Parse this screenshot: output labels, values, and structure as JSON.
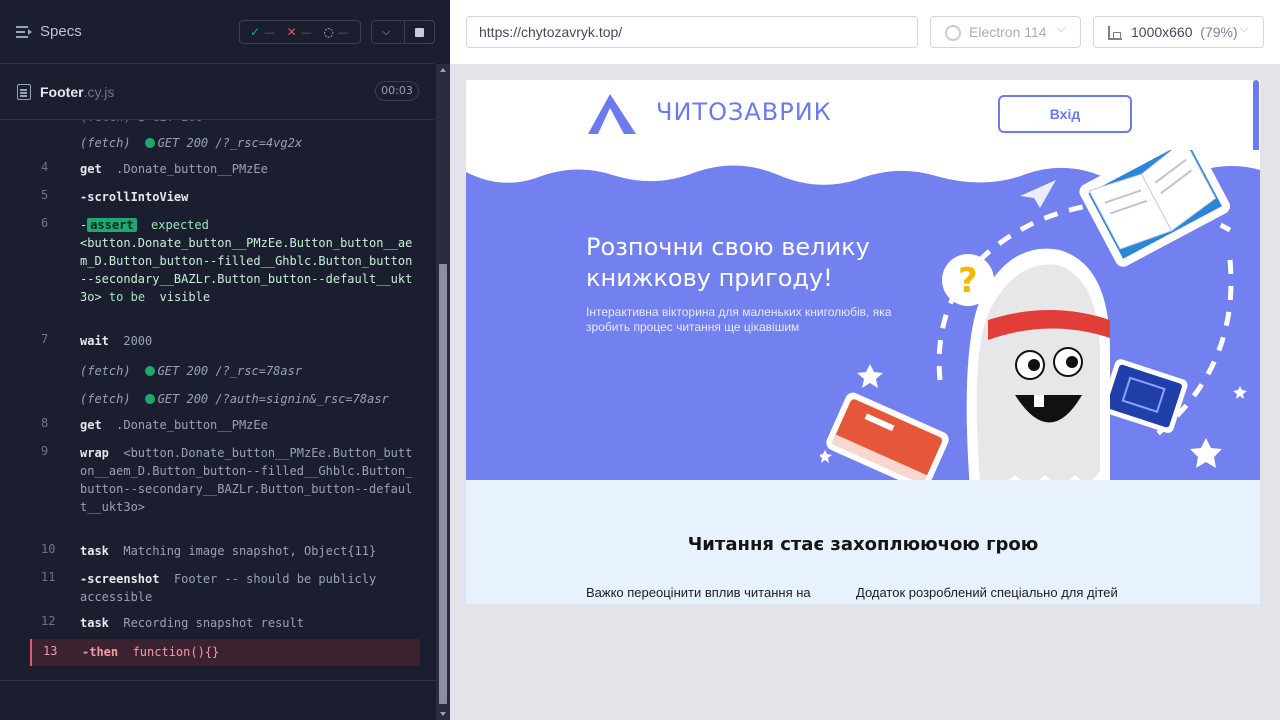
{
  "reporter": {
    "specs_label": "Specs",
    "stats": {
      "passed": "—",
      "failed": "—",
      "pending": "—"
    },
    "file": {
      "name": "Footer",
      "ext": ".cy.js",
      "duration": "00:03"
    },
    "commands": [
      {
        "type": "fetch",
        "text": "(fetch)",
        "method": "GET 200 /?_rsc=4vg2x"
      },
      {
        "num": "4",
        "cmd": "get",
        "msg": ".Donate_button__PMzEe"
      },
      {
        "num": "5",
        "cmd": "-scrollIntoView",
        "msg": ""
      },
      {
        "num": "6",
        "cmd": "-",
        "badge": "assert",
        "msg1": "expected",
        "msg2": "<button.Donate_button__PMzEe.Button_button__aem_D.Button_button--filled__Ghblc.Button_button--secondary__BAZLr.Button_button--default__ukt3o>",
        "msg3": "to be",
        "msg4": "visible"
      },
      {
        "num": "7",
        "cmd": "wait",
        "msg": "2000"
      },
      {
        "type": "fetch",
        "text": "(fetch)",
        "method": "GET 200 /?_rsc=78asr"
      },
      {
        "type": "fetch",
        "text": "(fetch)",
        "method": "GET 200 /?auth=signin&_rsc=78asr"
      },
      {
        "num": "8",
        "cmd": "get",
        "msg": ".Donate_button__PMzEe"
      },
      {
        "num": "9",
        "cmd": "wrap",
        "msg": "<button.Donate_button__PMzEe.Button_button__aem_D.Button_button--filled__Ghblc.Button_button--secondary__BAZLr.Button_button--default__ukt3o>"
      },
      {
        "num": "10",
        "cmd": "task",
        "msg": "Matching image snapshot, Object{11}"
      },
      {
        "num": "11",
        "cmd": "-screenshot",
        "msg": "Footer -- should be publicly accessible"
      },
      {
        "num": "12",
        "cmd": "task",
        "msg": "Recording snapshot result"
      },
      {
        "num": "13",
        "cmd": "-then",
        "msg": "function(){}"
      }
    ]
  },
  "aut": {
    "url": "https://chytozavryk.top/",
    "browser": "Electron 114",
    "viewport": "1000x660",
    "viewport_pct": "(79%)",
    "site": {
      "logo_text": "ЧИТОЗАВРИК",
      "login": "Вхід",
      "hero_title": "Розпочни свою велику книжкову пригоду!",
      "hero_sub": "Інтерактивна вікторина для маленьких книголюбів, яка зробить процес читання ще цікавішим",
      "section_title": "Читання стає захоплюючою грою",
      "col1": "Важко переоцінити вплив читання на",
      "col2": "Додаток розроблений спеціально для дітей"
    },
    "colors": {
      "brand": "#6b7bed",
      "hero_bg": "#7280f0",
      "section_bg": "#e8f1fe"
    }
  }
}
